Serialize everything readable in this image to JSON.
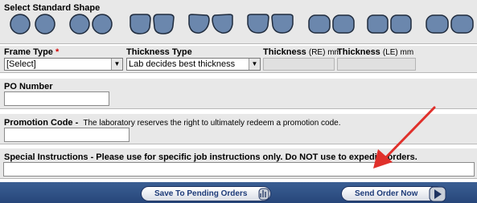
{
  "shapes": {
    "title": "Select Standard Shape",
    "items": [
      {
        "icon": "shape-round-icon"
      },
      {
        "icon": "shape-oval-icon"
      },
      {
        "icon": "shape-rounded-icon"
      },
      {
        "icon": "shape-aviator-icon"
      },
      {
        "icon": "shape-wayfarer-icon"
      },
      {
        "icon": "shape-rectangle-icon"
      },
      {
        "icon": "shape-square-icon"
      },
      {
        "icon": "shape-rounded-rect-icon"
      }
    ],
    "fill": "#6b87ad",
    "stroke": "#1f2b3d"
  },
  "frame": {
    "frame_type_label": "Frame Type",
    "required_mark": "*",
    "frame_type_value": "[Select]",
    "thickness_type_label": "Thickness Type",
    "thickness_type_value": "Lab decides best thickness",
    "thickness_re_label": "Thickness",
    "thickness_re_suffix": "(RE) mm",
    "thickness_le_label": "Thickness",
    "thickness_le_suffix": "(LE) mm"
  },
  "po": {
    "label": "PO Number",
    "value": ""
  },
  "promotion": {
    "label": "Promotion Code -",
    "note": "The laboratory reserves the right to ultimately redeem a promotion code.",
    "value": ""
  },
  "special": {
    "label": "Special Instructions - Please use for specific job instructions only. Do NOT use to expedite orders.",
    "value": ""
  },
  "footer": {
    "save_label": "Save To Pending Orders",
    "send_label": "Send Order Now",
    "bar_color": "#2f4f84"
  },
  "annotation": {
    "arrow_color": "#e0302b"
  }
}
